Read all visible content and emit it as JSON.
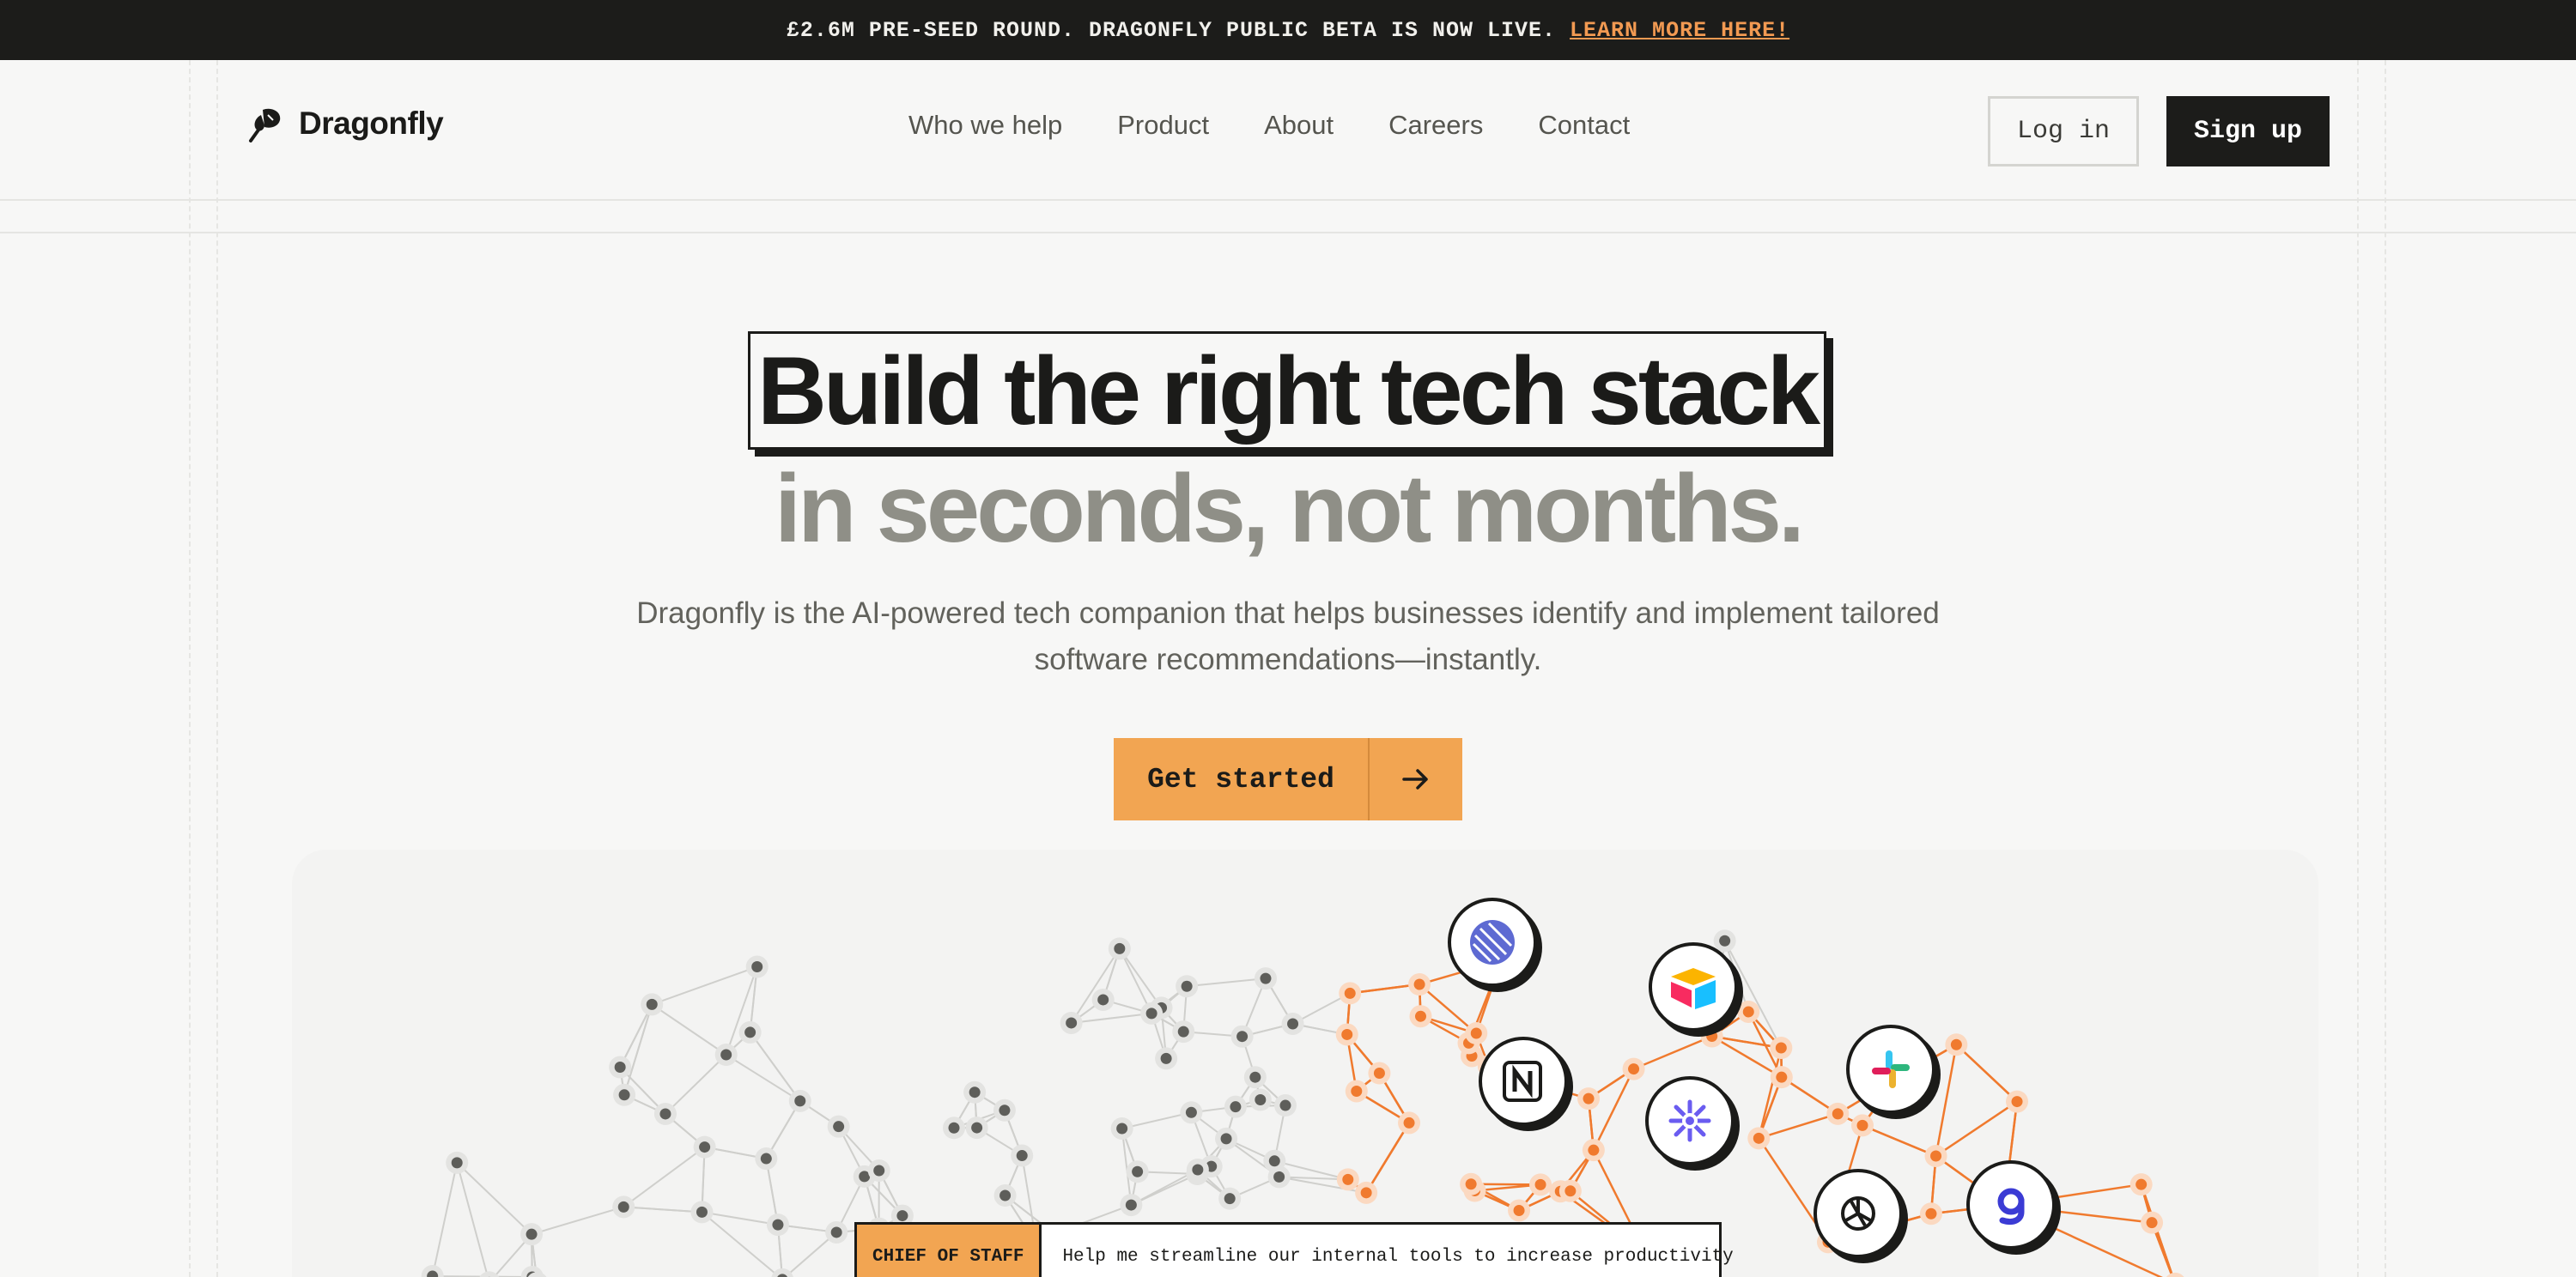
{
  "announcement": {
    "text": "£2.6M PRE-SEED ROUND. DRAGONFLY PUBLIC BETA IS NOW LIVE.",
    "link": "LEARN MORE HERE!"
  },
  "header": {
    "brand": "Dragonfly",
    "nav": [
      "Who we help",
      "Product",
      "About",
      "Careers",
      "Contact"
    ],
    "login": "Log in",
    "signup": "Sign up"
  },
  "hero": {
    "headline": "Build the right tech stack",
    "headline2": "in seconds, not months.",
    "description": "Dragonfly is the AI-powered tech companion that helps businesses identify and implement tailored software recommendations—instantly.",
    "cta": "Get started"
  },
  "apps": [
    "linear-icon",
    "airtable-icon",
    "notion-icon",
    "perplexity-icon",
    "slack-icon",
    "openai-icon",
    "gather-icon"
  ],
  "prompt": {
    "tag": "CHIEF OF STAFF",
    "text": "Help me streamline our internal tools to increase productivity"
  },
  "colors": {
    "accent": "#f2a552",
    "dark": "#1c1c1a",
    "network_orange": "#f07a2e",
    "background": "#f7f7f6"
  }
}
